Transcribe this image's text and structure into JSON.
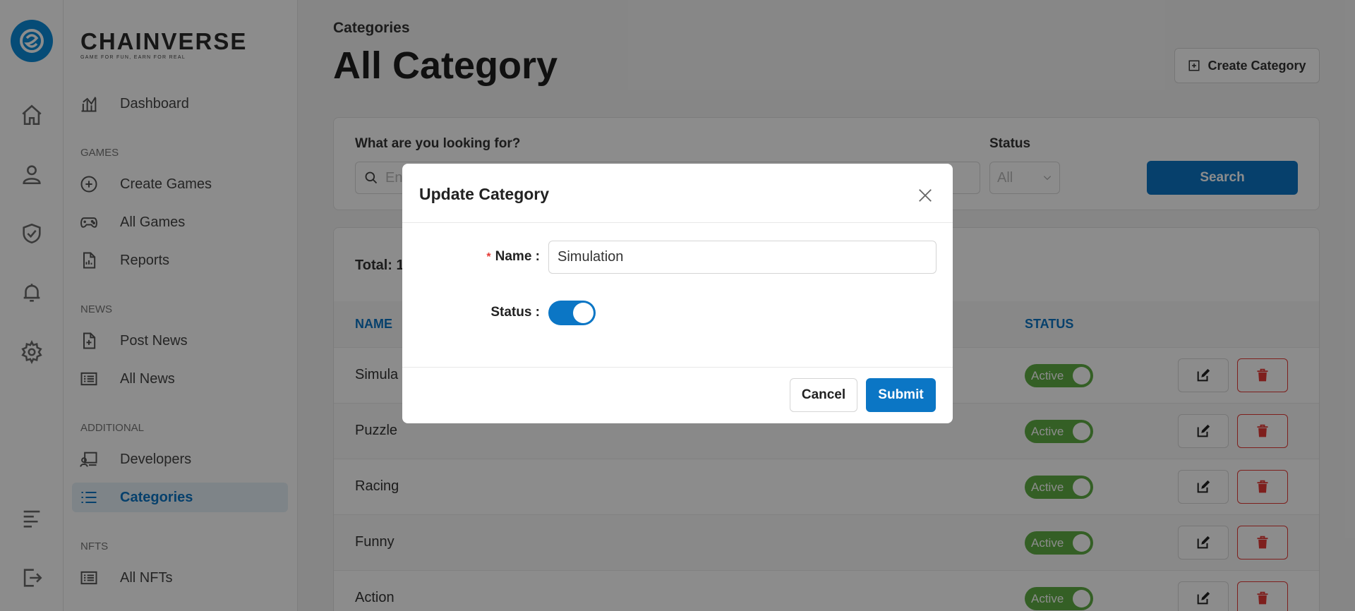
{
  "brand": {
    "name": "CHAINVERSE",
    "tagline": "GAME FOR FUN, EARN FOR REAL"
  },
  "rail": {
    "icons": [
      "home-icon",
      "user-icon",
      "shield-check-icon",
      "bell-icon",
      "gear-icon",
      "menu-icon",
      "logout-icon"
    ]
  },
  "sidebar": {
    "dashboard": "Dashboard",
    "sections": {
      "games": "GAMES",
      "news": "NEWS",
      "additional": "ADDITIONAL",
      "nfts": "NFTS"
    },
    "items": {
      "create_games": "Create Games",
      "all_games": "All Games",
      "reports": "Reports",
      "post_news": "Post News",
      "all_news": "All News",
      "developers": "Developers",
      "categories": "Categories",
      "all_nfts": "All NFTs"
    },
    "active": "Categories"
  },
  "header": {
    "breadcrumb": "Categories",
    "title": "All Category",
    "create_button": "Create Category"
  },
  "filter": {
    "query_label": "What are you looking for?",
    "query_placeholder": "Ent",
    "status_label": "Status",
    "status_value": "All",
    "search_button": "Search"
  },
  "table": {
    "total_label": "Total: 1",
    "headers": {
      "name": "NAME",
      "status": "STATUS"
    },
    "rows": [
      {
        "name": "Simula",
        "status": "Active"
      },
      {
        "name": "Puzzle",
        "status": "Active"
      },
      {
        "name": "Racing",
        "status": "Active"
      },
      {
        "name": "Funny",
        "status": "Active"
      },
      {
        "name": "Action",
        "status": "Active"
      }
    ]
  },
  "modal": {
    "title": "Update Category",
    "name_label": "Name",
    "name_value": "Simulation",
    "status_label": "Status",
    "status_on": true,
    "cancel": "Cancel",
    "submit": "Submit"
  },
  "colors": {
    "primary": "#0b76c5",
    "active_green": "#5fae44",
    "danger": "#e53935"
  }
}
